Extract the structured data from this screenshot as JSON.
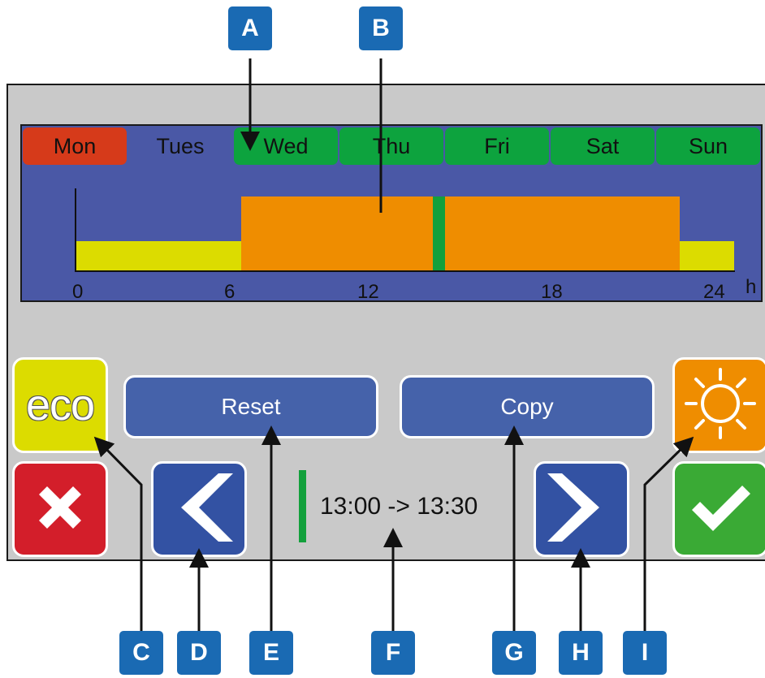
{
  "days": [
    {
      "label": "Mon",
      "color": "#d63a1a"
    },
    {
      "label": "Tues",
      "color": "#4a58a6"
    },
    {
      "label": "Wed",
      "color": "#0da33e"
    },
    {
      "label": "Thu",
      "color": "#0da33e"
    },
    {
      "label": "Fri",
      "color": "#0da33e"
    },
    {
      "label": "Sat",
      "color": "#0da33e"
    },
    {
      "label": "Sun",
      "color": "#0da33e"
    }
  ],
  "schedule": {
    "x_range": [
      0,
      24
    ],
    "x_ticks": [
      "0",
      "6",
      "12",
      "18",
      "24"
    ],
    "unit": "h",
    "segments": [
      {
        "start": 0,
        "end": 6,
        "level": "eco",
        "color": "#dcdc00"
      },
      {
        "start": 6,
        "end": 22,
        "level": "comfort",
        "color": "#ef8d00"
      },
      {
        "start": 22,
        "end": 24,
        "level": "eco",
        "color": "#dcdc00"
      }
    ],
    "marker": {
      "start": 13.0,
      "end": 13.5,
      "color": "#13a03c"
    }
  },
  "buttons": {
    "eco_label": "eco",
    "reset_label": "Reset",
    "copy_label": "Copy"
  },
  "time_range": "13:00 -> 13:30",
  "callouts": [
    "A",
    "B",
    "C",
    "D",
    "E",
    "F",
    "G",
    "H",
    "I"
  ],
  "colors": {
    "panel": "#c9c9c9",
    "schedule_bg": "#4a58a6",
    "button_blue": "#4562aa",
    "cancel_red": "#d31e2a",
    "confirm_green": "#3aaa35",
    "comfort_orange": "#ef8d00",
    "eco_yellow": "#dcdc00",
    "callout_blue": "#1a6ab3"
  },
  "icons": [
    "close-icon",
    "chevron-left-icon",
    "chevron-right-icon",
    "sun-icon",
    "check-icon"
  ]
}
